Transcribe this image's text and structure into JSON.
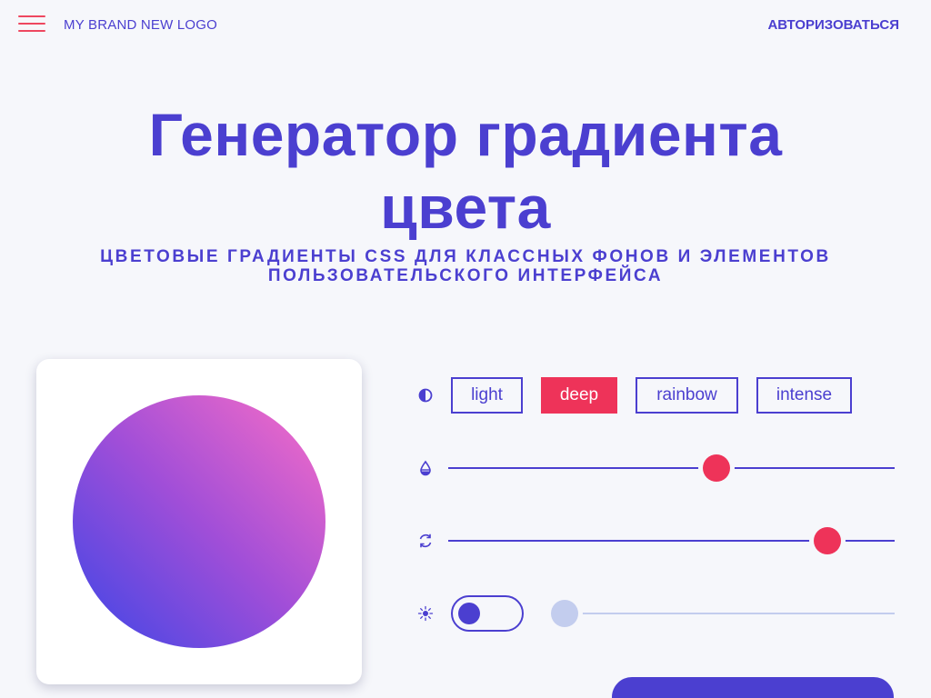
{
  "header": {
    "logo_text": "MY BRAND NEW LOGO",
    "login_label": "АВТОРИЗОВАТЬСЯ"
  },
  "hero": {
    "title_line1": "Генератор градиента",
    "title_line2": "цвета",
    "subtitle_line1": "ЦВЕТОВЫЕ ГРАДИЕНТЫ CSS ДЛЯ КЛАССНЫХ ФОНОВ И ЭЛЕМЕНТОВ",
    "subtitle_line2": "ПОЛЬЗОВАТЕЛЬСКОГО ИНТЕРФЕЙСА"
  },
  "preview": {
    "gradient_colors": [
      "#3c46e6",
      "#a04ed8",
      "#fa6ec6"
    ]
  },
  "controls": {
    "modes": [
      "light",
      "deep",
      "rainbow",
      "intense"
    ],
    "selected_mode": "deep",
    "slider_1_value": 0.6,
    "slider_2_value": 0.85,
    "toggle_on": false,
    "slider_3_value": 0.0
  },
  "colors": {
    "accent": "#4b3fd0",
    "highlight": "#ee3359",
    "background": "#f6f7fb",
    "muted": "#c3cdee"
  },
  "icons": {
    "menu": "hamburger-menu-icon",
    "contrast": "contrast-icon",
    "drop": "drop-icon",
    "rotate": "rotate-icon",
    "sparkle": "sparkle-icon"
  }
}
